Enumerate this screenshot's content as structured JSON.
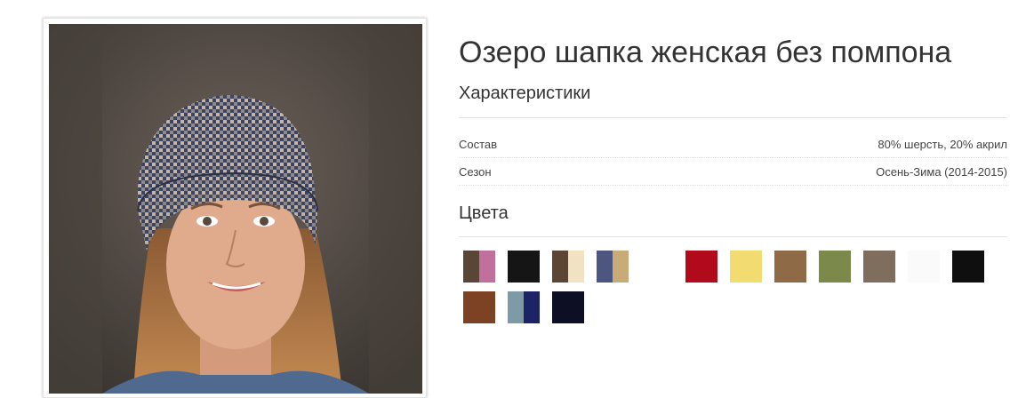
{
  "product": {
    "title": "Озеро шапка женская без помпона",
    "characteristics_heading": "Характеристики",
    "specs": [
      {
        "label": "Состав",
        "value": "80% шерсть, 20% акрил"
      },
      {
        "label": "Сезон",
        "value": "Осень-Зима (2014-2015)"
      }
    ],
    "colors_heading": "Цвета"
  },
  "colors": [
    {
      "name": "brown-pink",
      "c1": "#5a4636",
      "c2": "#c0709a"
    },
    {
      "name": "black-textured",
      "c1": "#151515",
      "c2": "#151515"
    },
    {
      "name": "brown-cream",
      "c1": "#5c4532",
      "c2": "#f1e2c2"
    },
    {
      "name": "navy-tan",
      "c1": "#4d5680",
      "c2": "#c9ab78"
    },
    {
      "name": "white",
      "c1": "#ffffff",
      "c2": "#ffffff"
    },
    {
      "name": "red",
      "c1": "#b10a1a",
      "c2": "#b10a1a"
    },
    {
      "name": "yellow",
      "c1": "#f2dc72",
      "c2": "#f2dc72"
    },
    {
      "name": "camel",
      "c1": "#8f6a47",
      "c2": "#8f6a47"
    },
    {
      "name": "olive",
      "c1": "#7b8a4a",
      "c2": "#7b8a4a"
    },
    {
      "name": "taupe",
      "c1": "#7f6e5d",
      "c2": "#7f6e5d"
    },
    {
      "name": "off-white",
      "c1": "#fafafa",
      "c2": "#fafafa"
    },
    {
      "name": "black",
      "c1": "#0f0f0f",
      "c2": "#0f0f0f"
    },
    {
      "name": "rust-knit",
      "c1": "#7d4224",
      "c2": "#7d4224"
    },
    {
      "name": "gray-navy",
      "c1": "#7d9aa6",
      "c2": "#1c2466"
    },
    {
      "name": "dark-navy",
      "c1": "#0d1024",
      "c2": "#0d1024"
    }
  ]
}
